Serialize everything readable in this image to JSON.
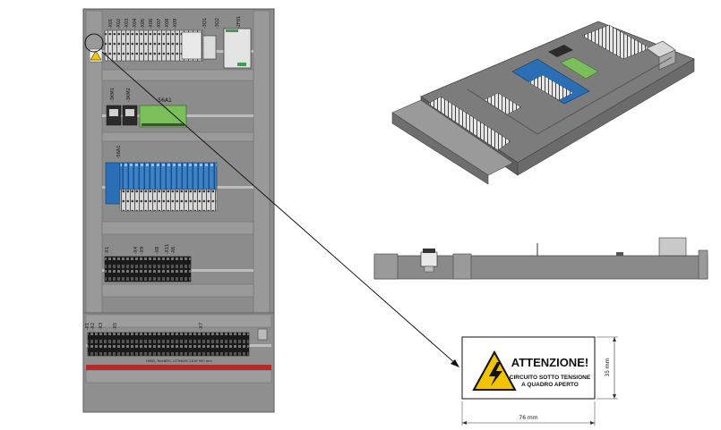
{
  "front_view": {
    "top_terminal_tags": [
      "-X01",
      "-X02",
      "-X03",
      "-X04",
      "-X05",
      "-X06",
      "-X07",
      "-X08",
      "-X09",
      "-3Q1",
      "-3Q2",
      "-2F01"
    ],
    "relay_tags": [
      "-3KM1",
      "-3KM2"
    ],
    "io_board_tag": "-56A1",
    "plc_tag": "-56A1",
    "lower_terminal_tags": [
      "-X1",
      "-X4",
      "-X9",
      "-X8",
      "-X11",
      "-X6"
    ],
    "bottom_terminal_tags": [
      "-X1",
      "-X2",
      "-X3",
      "-X5",
      "-X7"
    ],
    "rail_label": "HMID, TereNIPC, UTTeNIPC 2016 900 mm"
  },
  "warning_label": {
    "title": "ATTENZIONE!",
    "line1": "CIRCUITO SOTTO TENSIONE",
    "line2": "A QUADRO APERTO",
    "width_dim": "76 mm",
    "height_dim": "35 mm"
  },
  "colors": {
    "cabinet_gray": "#8c8c8c",
    "accent_blue": "#2a6fb6",
    "warning_yellow": "#f2c300",
    "pcb_green": "#7bbf5a",
    "rail_red": "#b52a2a"
  }
}
